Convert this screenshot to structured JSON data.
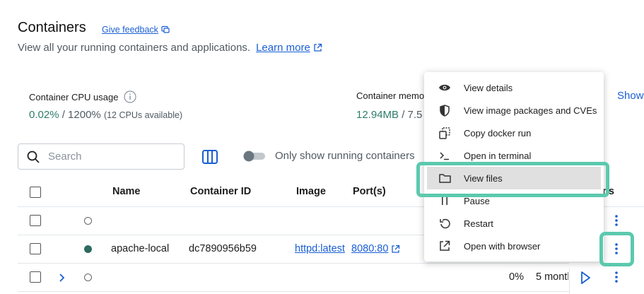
{
  "page": {
    "title": "Containers",
    "feedback": "Give feedback",
    "subtitle": "View all your running containers and applications.",
    "learn_more": "Learn more"
  },
  "stats": {
    "cpu_label": "Container CPU usage",
    "cpu_value": "0.02% / 1200%",
    "cpu_value_num": "0.02%",
    "cpu_value_rest": " / 1200% ",
    "cpu_note": "(12 CPUs available)",
    "mem_label": "Container memor",
    "mem_value_num": "12.94MB",
    "mem_value_rest": " / 7.5",
    "show_link": "Show"
  },
  "toolbar": {
    "search_placeholder": "Search",
    "toggle_label": "Only show running containers",
    "toggle_on": false
  },
  "table": {
    "headers": {
      "name": "Name",
      "container_id": "Container ID",
      "image": "Image",
      "ports": "Port(s)",
      "actions": "ns"
    },
    "rows": [
      {
        "name": "",
        "container_id": "",
        "image": "",
        "ports": "",
        "status": "stopped",
        "cpu": "",
        "last_started": ""
      },
      {
        "name": "apache-local",
        "container_id": "dc7890956b59",
        "image": "httpd:latest",
        "ports": "8080:80",
        "status": "running",
        "cpu": "",
        "last_started": ""
      },
      {
        "name": "",
        "container_id": "",
        "image": "",
        "ports": "",
        "status": "stopped",
        "expandable": true,
        "cpu": "0%",
        "last_started": "5 month"
      }
    ]
  },
  "context_menu": {
    "items": [
      {
        "label": "View details",
        "icon": "eye-icon"
      },
      {
        "label": "View image packages and CVEs",
        "icon": "shield-icon"
      },
      {
        "label": "Copy docker run",
        "icon": "copy-icon"
      },
      {
        "label": "Open in terminal",
        "icon": "terminal-icon"
      },
      {
        "label": "View files",
        "icon": "folder-icon"
      },
      {
        "label": "Pause",
        "icon": "pause-icon"
      },
      {
        "label": "Restart",
        "icon": "restart-icon"
      },
      {
        "label": "Open with browser",
        "icon": "external-link-icon"
      }
    ],
    "active_index": 4
  },
  "colors": {
    "accent": "#1a5fd4",
    "running": "#2e6a5e",
    "highlight": "#5cc9ae"
  }
}
